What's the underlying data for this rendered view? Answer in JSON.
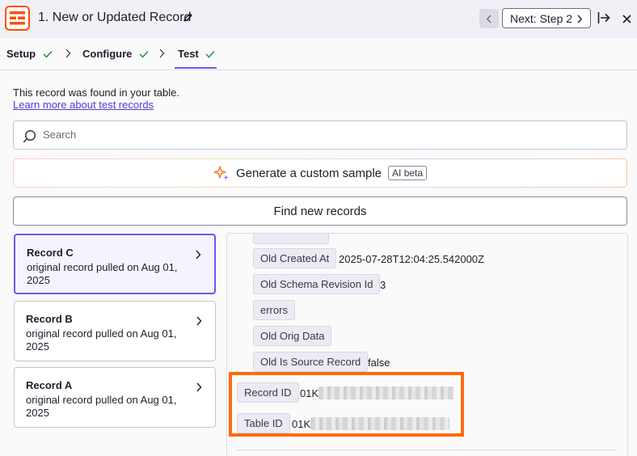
{
  "header": {
    "title": "1. New or Updated Record",
    "next_label": "Next: Step 2",
    "brand_color": "#ff4f00"
  },
  "tabs": [
    {
      "label": "Setup",
      "complete": true
    },
    {
      "label": "Configure",
      "complete": true
    },
    {
      "label": "Test",
      "complete": true,
      "active": true
    }
  ],
  "intro": {
    "found_text": "This record was found in your table.",
    "learn_link": "Learn more about test records"
  },
  "search": {
    "placeholder": "Search",
    "value": ""
  },
  "generate": {
    "label": "Generate a custom sample",
    "badge": "AI beta"
  },
  "find_button": "Find new records",
  "records": [
    {
      "name": "Record C",
      "desc": "original record pulled on Aug 01, 2025",
      "selected": true
    },
    {
      "name": "Record B",
      "desc": "original record pulled on Aug 01, 2025",
      "selected": false
    },
    {
      "name": "Record A",
      "desc": "original record pulled on Aug 01, 2025",
      "selected": false
    }
  ],
  "fields": [
    {
      "label": "Old Created At",
      "value": "2025-07-28T12:04:25.542000Z"
    },
    {
      "label": "Old Schema Revision Id",
      "value": "3"
    },
    {
      "label": "errors",
      "value": ""
    },
    {
      "label": "Old Orig Data",
      "value": ""
    },
    {
      "label": "Old Is Source Record",
      "value": "false"
    },
    {
      "label": "Record ID",
      "value": "01K"
    },
    {
      "label": "Table ID",
      "value": "01K"
    }
  ],
  "colors": {
    "accent": "#695be8",
    "highlight": "#ff6a10",
    "check": "#2f8c3f"
  }
}
